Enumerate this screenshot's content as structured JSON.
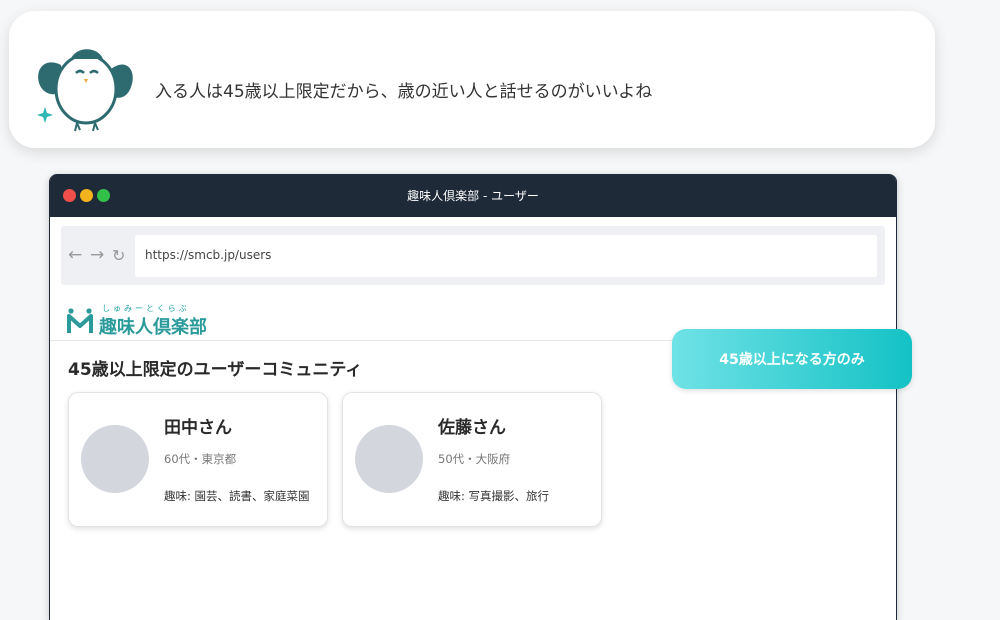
{
  "bubble": {
    "text": "入る人は45歳以上限定だから、歳の近い人と話せるのがいいよね",
    "colors": {
      "bird": "#2d6b70",
      "sparkle": "#2fb6b6"
    }
  },
  "window": {
    "title": "趣味人倶楽部 - ユーザー",
    "traffic_lights": [
      "#ee4f4a",
      "#f2b31e",
      "#33c049"
    ]
  },
  "toolbar": {
    "back_icon": "←",
    "forward_icon": "→",
    "reload_icon": "↻",
    "url": "https://smcb.jp/users"
  },
  "site": {
    "logo_ruby": "しゅみーとくらぶ",
    "logo_text": "趣味人倶楽部",
    "brand_color": "#2b9a9a"
  },
  "page": {
    "heading": "45歳以上限定のユーザーコミュニティ"
  },
  "users": [
    {
      "name": "田中さん",
      "meta": "60代・東京都",
      "hobby": "趣味: 園芸、読書、家庭菜園"
    },
    {
      "name": "佐藤さん",
      "meta": "50代・大阪府",
      "hobby": "趣味: 写真撮影、旅行"
    }
  ],
  "badge": {
    "text": "45歳以上になる方のみ",
    "gradient": [
      "#6fe2e6",
      "#14c2c5"
    ]
  }
}
